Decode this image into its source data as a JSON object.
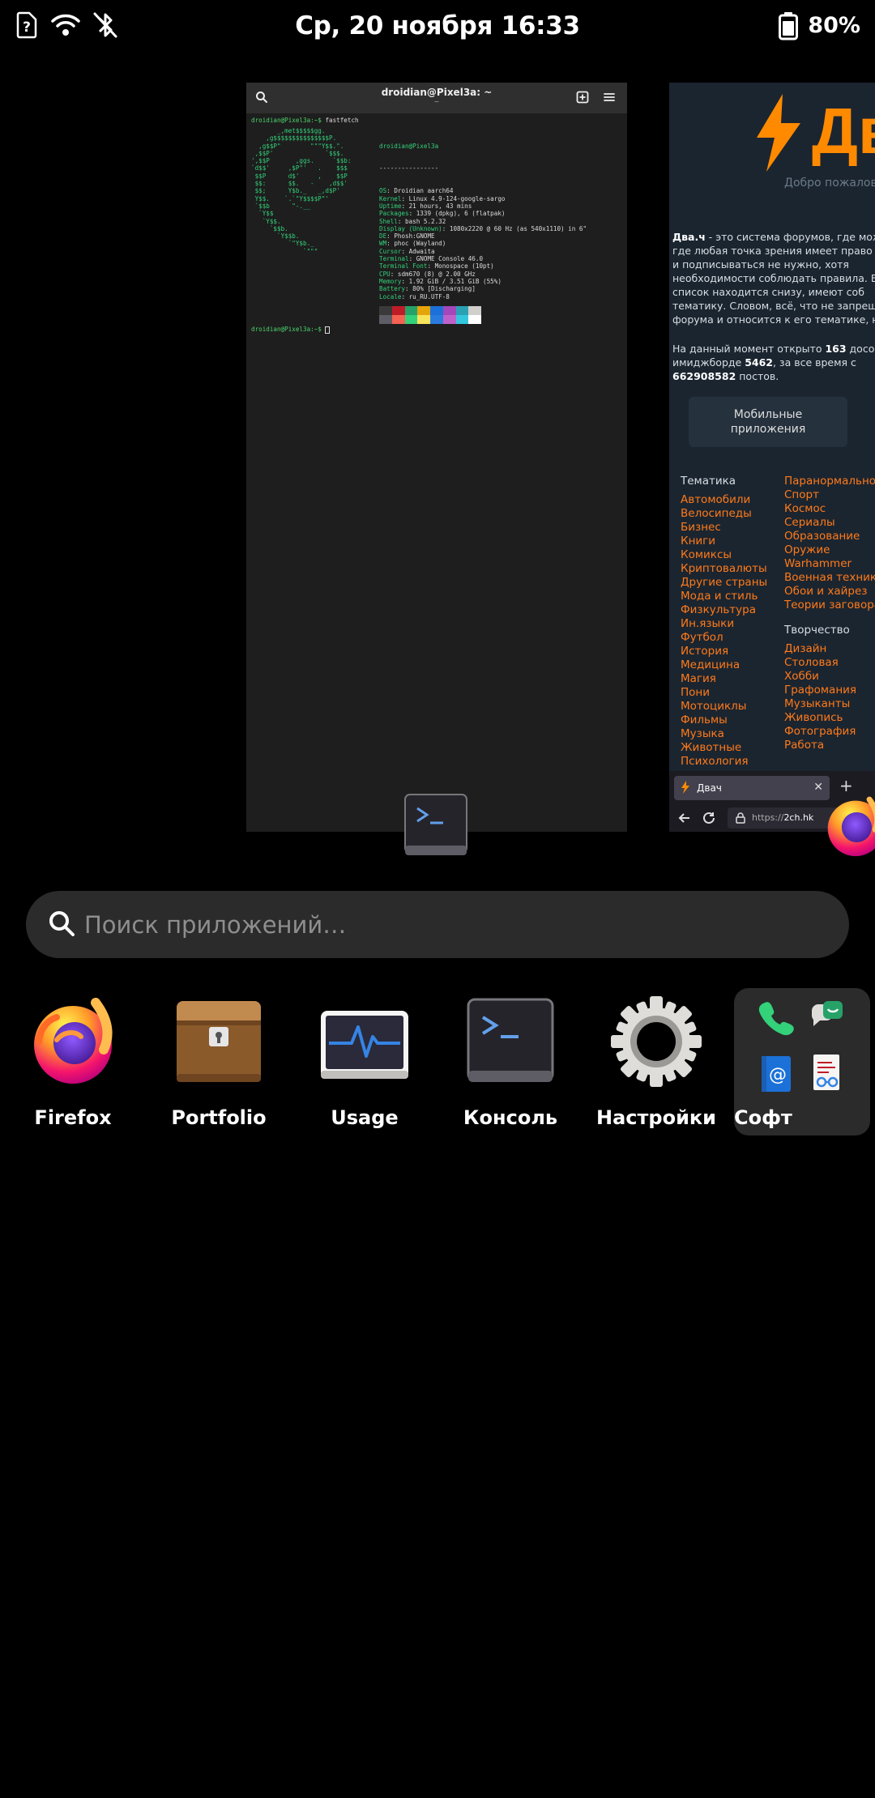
{
  "status_bar": {
    "datetime": "Ср, 20 ноября   16:33",
    "battery_percent": "80%"
  },
  "terminal_window": {
    "title": "droidian@Pixel3a: ~",
    "subtitle": "~",
    "prompt": "droidian@Pixel3a:~$",
    "command": " fastfetch",
    "header": "droidian@Pixel3a",
    "separator": "----------------",
    "info": [
      {
        "key": "OS",
        "value": "Droidian aarch64"
      },
      {
        "key": "Kernel",
        "value": "Linux 4.9-124-google-sargo"
      },
      {
        "key": "Uptime",
        "value": "21 hours, 43 mins"
      },
      {
        "key": "Packages",
        "value": "1339 (dpkg), 6 (flatpak)"
      },
      {
        "key": "Shell",
        "value": "bash 5.2.32"
      },
      {
        "key": "Display (Unknown)",
        "value": "1080x2220 @ 60 Hz (as 540x1110) in 6\""
      },
      {
        "key": "DE",
        "value": "Phosh:GNOME"
      },
      {
        "key": "WM",
        "value": "phoc (Wayland)"
      },
      {
        "key": "Cursor",
        "value": "Adwaita"
      },
      {
        "key": "Terminal",
        "value": "GNOME Console 46.0"
      },
      {
        "key": "Terminal Font",
        "value": "Monospace (10pt)"
      },
      {
        "key": "CPU",
        "value": "sdm670 (8) @ 2.00 GHz"
      },
      {
        "key": "Memory",
        "value": "1.92 GiB / 3.51 GiB (55%)"
      },
      {
        "key": "Battery",
        "value": "80% [Discharging]"
      },
      {
        "key": "Locale",
        "value": "ru_RU.UTF-8"
      }
    ],
    "ascii_art": "       _,met$$$$$gg.\n    ,g$$$$$$$$$$$$$$$P.\n  ,g$$P\"        \"\"\"Y$$.\".\n ,$$P'              `$$$.\n',$$P       ,ggs.     `$$b:\n`d$$'     ,$P\"'   .    $$$\n $$P      d$'     ,    $$P\n $$:      $$.   -    ,d$$'\n $$;      Y$b._   _,d$P'\n Y$$.    `.`\"Y$$$$P\"'\n `$$b      \"-.__\n  `Y$$\n   `Y$$.\n     `$$b.\n       `Y$$b.\n          `\"Y$b._\n              `\"\"\"",
    "palette_colors": [
      "#3a3a3a",
      "#c01c28",
      "#26a269",
      "#e5a50a",
      "#1c71d8",
      "#a347ba",
      "#2aa1b3",
      "#d0cfcc",
      "#5e5c64",
      "#f66151",
      "#33d17a",
      "#f8e45c",
      "#2a7bde",
      "#c061cb",
      "#33c7de",
      "#ffffff"
    ]
  },
  "browser_window": {
    "logo_text": "Дв",
    "welcome": "Добро пожаловать",
    "intro_bold": "Два.ч",
    "intro_lines": [
      " - это система форумов, где мож",
      "где любая точка зрения имеет право н",
      "и подписываться не нужно, хотя",
      "необходимости соблюдать правила. В",
      "список находится снизу, имеют соб",
      "тематику. Словом, всё, что не запреще",
      "форума и относится к его тематике, на"
    ],
    "stats_line1": "На данный момент открыто ",
    "stats_boards": "163",
    "stats_line1_tail": " досо",
    "stats_line2": "имиджборде ",
    "stats_threads": "5462",
    "stats_line2_tail": ", за все время с",
    "stats_posts": "662908582",
    "stats_line3_tail": " постов.",
    "mobile_button": "Мобильные приложения",
    "col1_header": "Тематика",
    "col1_links": [
      "Автомобили",
      "Велосипеды",
      "Бизнес",
      "Книги",
      "Комиксы",
      "Криптовалюты",
      "Другие страны",
      "Мода и стиль",
      "Физкультура",
      "Ин.языки",
      "Футбол",
      "История",
      "Медицина",
      "Магия",
      "Пони",
      "Мотоциклы",
      "Фильмы",
      "Музыка",
      "Животные",
      "Психология"
    ],
    "col2_links_top": [
      "Паранормальное",
      "Спорт",
      "Космос",
      "Сериалы",
      "Образование",
      "Оружие",
      "Warhammer",
      "Военная техника",
      "Обои и хайрез",
      "Теории заговора"
    ],
    "col2_header": "Творчество",
    "col2_links_bottom": [
      "Дизайн",
      "Столовая",
      "Хобби",
      "Графомания",
      "Музыканты",
      "Живопись",
      "Фотография",
      "Работа"
    ],
    "tab_title": "Двач",
    "url_prefix": "https://",
    "url_host": "2ch.hk"
  },
  "search": {
    "placeholder": "Поиск приложений…"
  },
  "apps": [
    {
      "label": "Firefox",
      "icon": "firefox-icon"
    },
    {
      "label": "Portfolio",
      "icon": "portfolio-icon"
    },
    {
      "label": "Usage",
      "icon": "usage-icon"
    },
    {
      "label": "Консоль",
      "icon": "console-icon"
    },
    {
      "label": "Настройки",
      "icon": "settings-icon"
    },
    {
      "label": "Софт",
      "icon": "folder-icon"
    }
  ],
  "colors": {
    "accent_orange": "#ff7a1a",
    "terminal_green": "#33d17a"
  }
}
